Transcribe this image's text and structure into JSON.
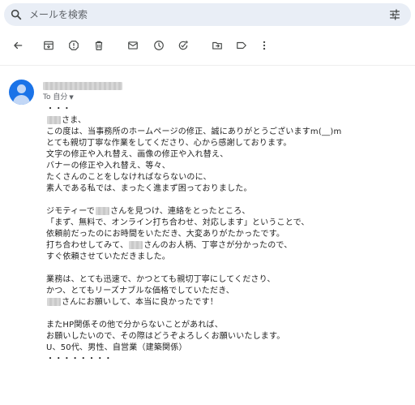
{
  "search": {
    "placeholder": "メールを検索",
    "icon": "search-icon",
    "filter_icon": "tune-icon"
  },
  "toolbar": {
    "items": [
      "back-arrow-icon",
      "archive-icon",
      "report-spam-icon",
      "delete-icon",
      "mark-unread-icon",
      "snooze-icon",
      "add-task-icon",
      "move-to-icon",
      "label-icon",
      "more-icon"
    ]
  },
  "email": {
    "to_label": "To 自分",
    "body_lines": [
      "・・・",
      "さま、",
      "この度は、当事務所のホームページの修正、誠にありがとうございますm(__)m",
      "とても親切丁寧な作業をしてくださり、心から感謝しております。",
      "文字の修正や入れ替え、画像の修正や入れ替え、",
      "バナーの修正や入れ替え、等々、",
      "たくさんのことをしなければならないのに、",
      "素人である私では、まったく進まず困っておりました。",
      "",
      "ジモティーで",
      "さんを見つけ、連絡をとったところ、",
      "「まず、無料で、オンライン打ち合わせ、対応します」ということで、",
      "依頼前だったのにお時間をいただき、大変ありがたかったです。",
      "打ち合わせしてみて、",
      "さんのお人柄、丁寧さが分かったので、",
      "すぐ依頼させていただきました。",
      "",
      "業務は、とても迅速で、かつとても親切丁寧にしてくださり、",
      "かつ、とてもリーズナブルな価格でしていただき、",
      "さんにお願いして、本当に良かったです！",
      "",
      "またHP関係その他で分からないことがあれば、",
      "お願いしたいので、その際はどうぞよろしくお願いいたします。",
      "U、50代、男性、自営業（建築関係）",
      "・・・・・・・・"
    ]
  },
  "colors": {
    "search_bg": "#e9eef6",
    "avatar_bg": "#1a73e8",
    "text": "#222222",
    "muted": "#5f6368"
  }
}
